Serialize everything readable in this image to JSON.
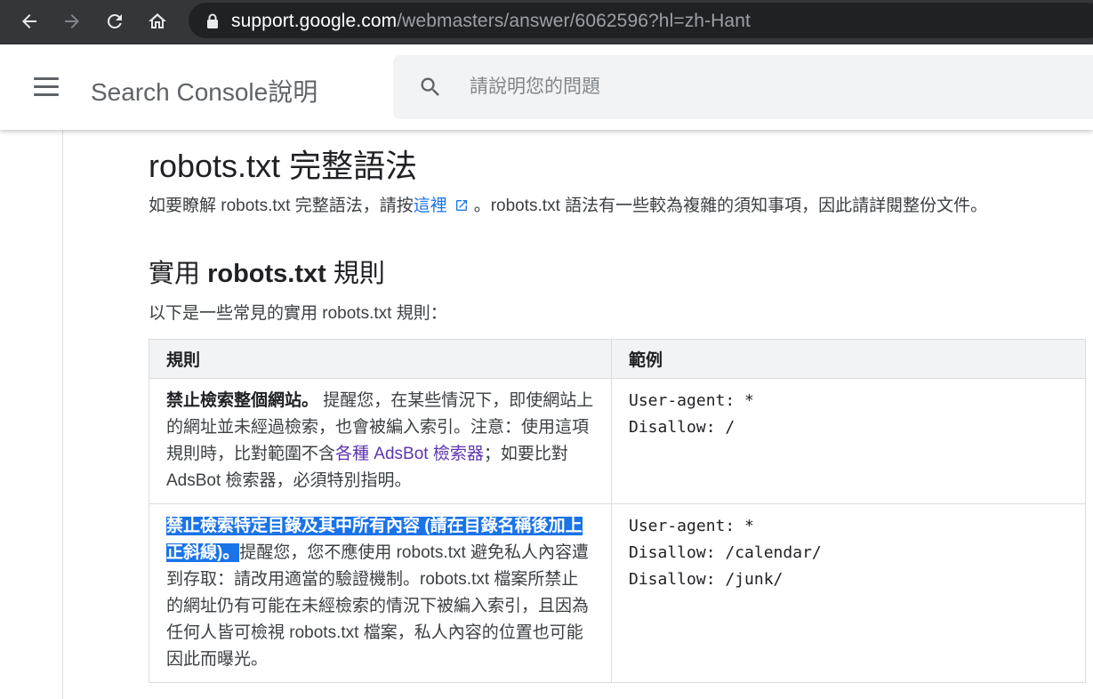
{
  "browser": {
    "url_host": "support.google.com",
    "url_path": "/webmasters/answer/6062596?hl=zh-Hant"
  },
  "header": {
    "title": "Search Console說明",
    "search_placeholder": "請說明您的問題"
  },
  "article": {
    "title": "robots.txt 完整語法",
    "intro_before": "如要瞭解 robots.txt 完整語法，請按",
    "intro_link": "這裡",
    "intro_after": "。robots.txt 語法有一些較為複雜的須知事項，因此請詳閱整份文件。",
    "section_prefix": "實用 ",
    "section_bold": "robots.txt",
    "section_suffix": " 規則",
    "section_lead": "以下是一些常見的實用 robots.txt 規則："
  },
  "table": {
    "headers": [
      "規則",
      "範例"
    ],
    "rows": [
      {
        "rule_name": "禁止檢索整個網站。",
        "rule_text_1": " 提醒您，在某些情況下，即使網站上的網址並未經過檢索，也會被編入索引。注意：使用這項規則時，比對範圍不含",
        "rule_link": "各種 AdsBot 檢索器",
        "rule_text_2": "；如要比對 AdsBot 檢索器，必須特別指明。",
        "example": "User-agent: *\nDisallow: /"
      },
      {
        "rule_name": "禁止檢索特定目錄及其中所有內容 (請在目錄名稱後加上正斜線)。",
        "rule_text_1": "提醒您，您不應使用 robots.txt 避免私人內容遭到存取：請改用適當的驗證機制。robots.txt 檔案所禁止的網址仍有可能在未經檢索的情況下被編入索引，且因為任何人皆可檢視 robots.txt 檔案，私人內容的位置也可能因此而曝光。",
        "example": "User-agent: *\nDisallow: /calendar/\nDisallow: /junk/"
      }
    ]
  },
  "colors": {
    "chrome_bg": "#35363a",
    "omnibox_bg": "#202124",
    "link": "#1a73e8",
    "visited_link": "#5e35b1",
    "selection": "#1a73e8"
  }
}
